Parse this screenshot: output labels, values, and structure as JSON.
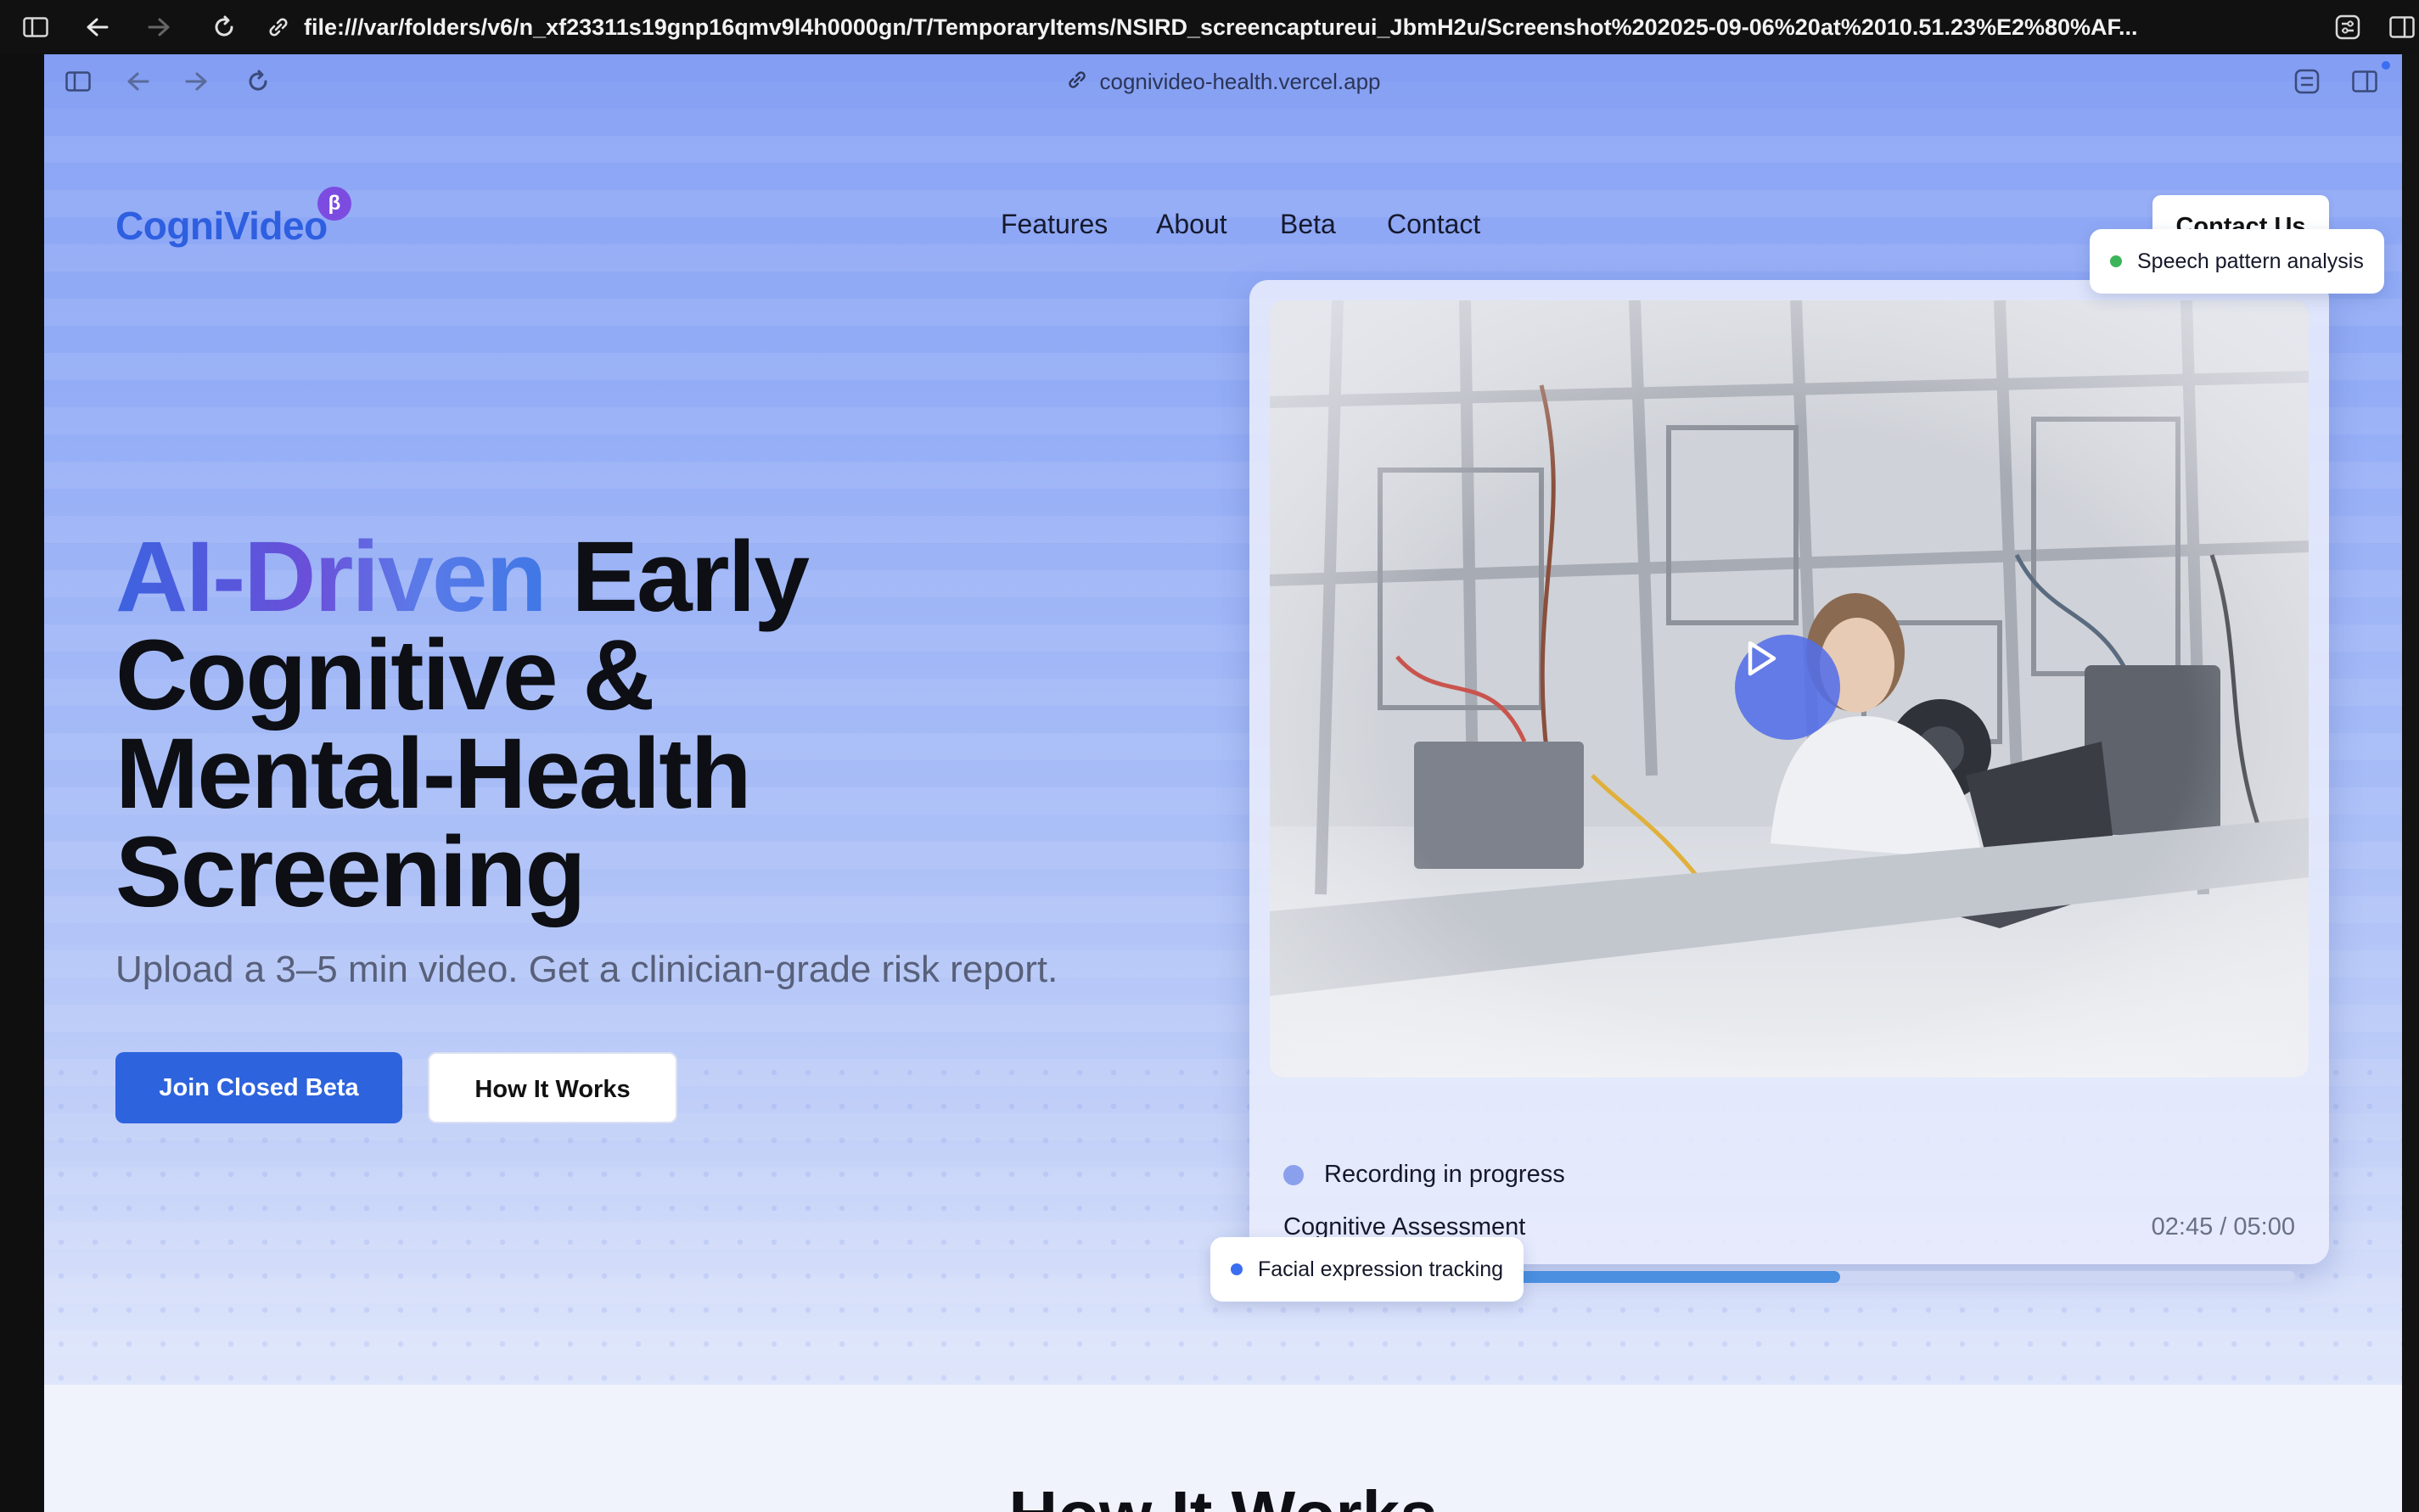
{
  "browser": {
    "outer_url": "file:///var/folders/v6/n_xf23311s19gnp16qmv9l4h0000gn/T/TemporaryItems/NSIRD_screencaptureui_JbmH2u/Screenshot%202025-09-06%20at%2010.51.23%E2%80%AF...",
    "inner_url": "cognivideo-health.vercel.app"
  },
  "brand": {
    "logo": "CogniVideo",
    "badge": "β",
    "accent": "#2e5fe0",
    "badge_color": "#7c4ce0"
  },
  "nav": {
    "items": [
      "Features",
      "About",
      "Beta",
      "Contact"
    ],
    "cta": "Contact Us"
  },
  "hero": {
    "title_gradient": "AI-Driven",
    "title_rest_1": " Early",
    "title_line_2": "Cognitive &",
    "title_line_3": "Mental-Health",
    "title_line_4": "Screening",
    "subtitle": "Upload a 3–5 min video. Get a clinician-grade risk report.",
    "primary_button": "Join Closed Beta",
    "secondary_button": "How It Works"
  },
  "video_card": {
    "recording_status": "Recording in progress",
    "assessment_label": "Cognitive Assessment",
    "time_display": "02:45 / 05:00",
    "progress_fraction": 0.55
  },
  "chips": {
    "speech": "Speech pattern analysis",
    "speech_color": "#3cb55a",
    "facial": "Facial expression tracking",
    "facial_color": "#3b6ef0"
  },
  "next_section": {
    "title": "How It Works"
  }
}
